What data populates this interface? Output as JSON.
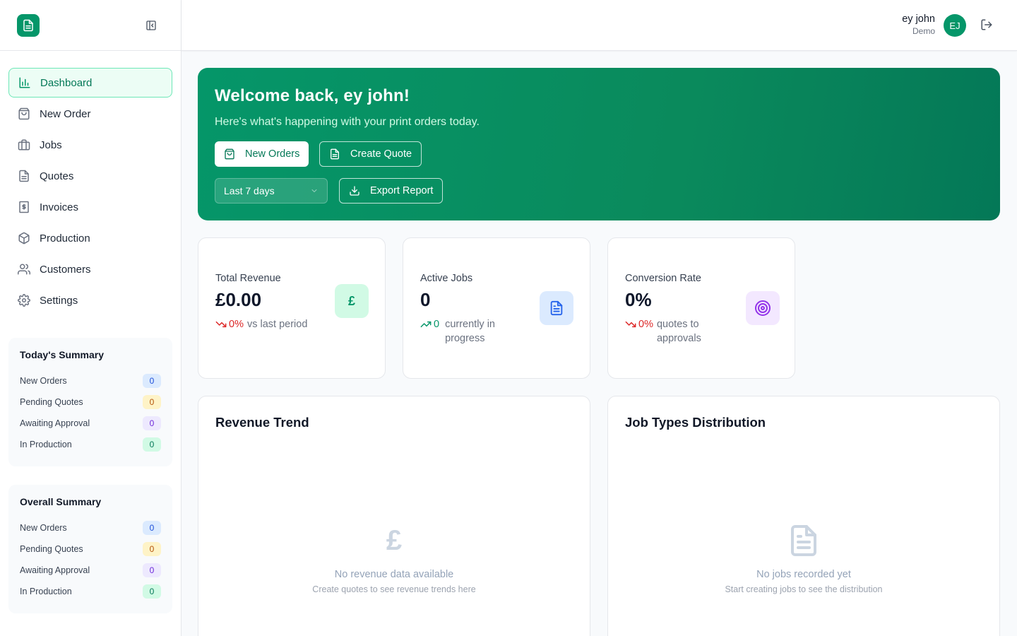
{
  "sidebar": {
    "nav": [
      {
        "label": "Dashboard",
        "icon": "bar-chart-icon",
        "active": true
      },
      {
        "label": "New Order",
        "icon": "shopping-bag-icon"
      },
      {
        "label": "Jobs",
        "icon": "briefcase-icon"
      },
      {
        "label": "Quotes",
        "icon": "file-text-icon"
      },
      {
        "label": "Invoices",
        "icon": "receipt-icon"
      },
      {
        "label": "Production",
        "icon": "package-icon"
      },
      {
        "label": "Customers",
        "icon": "users-icon"
      },
      {
        "label": "Settings",
        "icon": "gear-icon"
      }
    ],
    "today_summary": {
      "title": "Today's Summary",
      "rows": [
        {
          "label": "New Orders",
          "value": "0"
        },
        {
          "label": "Pending Quotes",
          "value": "0"
        },
        {
          "label": "Awaiting Approval",
          "value": "0"
        },
        {
          "label": "In Production",
          "value": "0"
        }
      ]
    },
    "overall_summary": {
      "title": "Overall Summary",
      "rows": [
        {
          "label": "New Orders",
          "value": "0"
        },
        {
          "label": "Pending Quotes",
          "value": "0"
        },
        {
          "label": "Awaiting Approval",
          "value": "0"
        },
        {
          "label": "In Production",
          "value": "0"
        }
      ]
    }
  },
  "header": {
    "user_name": "ey john",
    "user_role": "Demo",
    "avatar_initials": "EJ"
  },
  "hero": {
    "title": "Welcome back, ey john!",
    "subtitle": "Here's what's happening with your print orders today.",
    "new_orders_label": "New Orders",
    "create_quote_label": "Create Quote",
    "period_selected": "Last 7 days",
    "export_label": "Export Report"
  },
  "stats": {
    "revenue": {
      "label": "Total Revenue",
      "value": "£0.00",
      "pct": "0%",
      "note": "vs last period",
      "icon_glyph": "£"
    },
    "jobs": {
      "label": "Active Jobs",
      "value": "0",
      "pct": "0",
      "note": "currently in progress"
    },
    "conversion": {
      "label": "Conversion Rate",
      "value": "0%",
      "pct": "0%",
      "note": "quotes to approvals"
    }
  },
  "revenue_chart": {
    "title": "Revenue Trend",
    "icon_glyph": "£",
    "empty_title": "No revenue data available",
    "empty_sub": "Create quotes to see revenue trends here"
  },
  "jobs_chart": {
    "title": "Job Types Distribution",
    "empty_title": "No jobs recorded yet",
    "empty_sub": "Start creating jobs to see the distribution"
  },
  "colors": {
    "brand": "#059669",
    "brand_dark": "#047857",
    "negative": "#dc2626"
  }
}
